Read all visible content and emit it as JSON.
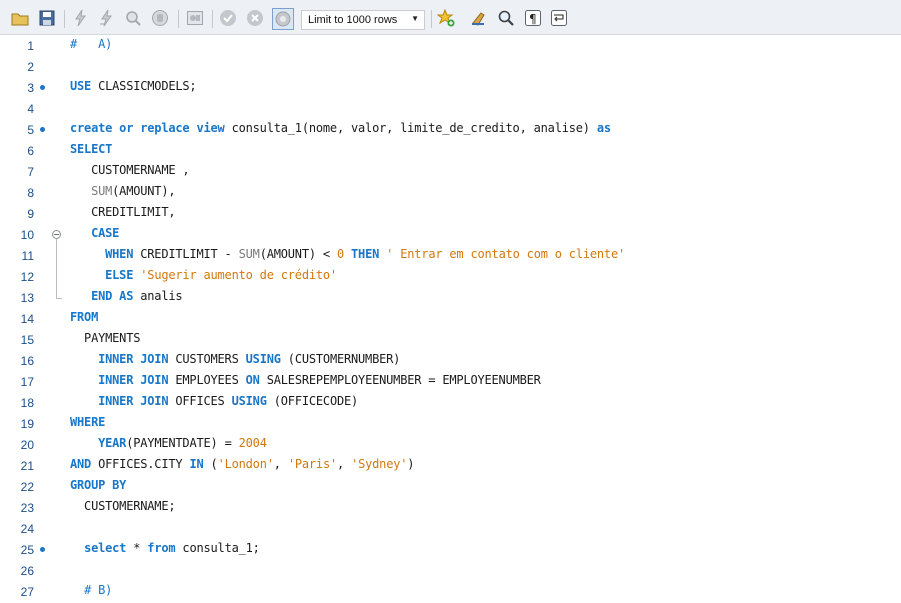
{
  "toolbar": {
    "limit_select_value": "Limit to 1000 rows"
  },
  "editor": {
    "lines": [
      {
        "n": "1",
        "dot": false,
        "tokens": [
          {
            "t": "#   A)",
            "c": "cm"
          }
        ]
      },
      {
        "n": "2",
        "dot": false,
        "tokens": []
      },
      {
        "n": "3",
        "dot": true,
        "tokens": [
          {
            "t": "USE",
            "c": "kw"
          },
          {
            "t": " CLASSICMODELS;",
            "c": ""
          }
        ]
      },
      {
        "n": "4",
        "dot": false,
        "tokens": []
      },
      {
        "n": "5",
        "dot": true,
        "tokens": [
          {
            "t": "create or replace view",
            "c": "kw"
          },
          {
            "t": " consulta_1(nome, valor, limite_de_credito, analise) ",
            "c": ""
          },
          {
            "t": "as",
            "c": "kw"
          }
        ]
      },
      {
        "n": "6",
        "dot": false,
        "tokens": [
          {
            "t": "SELECT",
            "c": "kw"
          }
        ]
      },
      {
        "n": "7",
        "dot": false,
        "tokens": [
          {
            "t": "   CUSTOMERNAME ,",
            "c": ""
          }
        ]
      },
      {
        "n": "8",
        "dot": false,
        "tokens": [
          {
            "t": "   ",
            "c": ""
          },
          {
            "t": "SUM",
            "c": "fn"
          },
          {
            "t": "(AMOUNT),",
            "c": ""
          }
        ]
      },
      {
        "n": "9",
        "dot": false,
        "tokens": [
          {
            "t": "   CREDITLIMIT,",
            "c": ""
          }
        ]
      },
      {
        "n": "10",
        "dot": false,
        "fold": "start",
        "tokens": [
          {
            "t": "   ",
            "c": ""
          },
          {
            "t": "CASE",
            "c": "kw"
          }
        ]
      },
      {
        "n": "11",
        "dot": false,
        "tokens": [
          {
            "t": "     ",
            "c": ""
          },
          {
            "t": "WHEN",
            "c": "kw"
          },
          {
            "t": " CREDITLIMIT - ",
            "c": ""
          },
          {
            "t": "SUM",
            "c": "fn"
          },
          {
            "t": "(AMOUNT) < ",
            "c": ""
          },
          {
            "t": "0",
            "c": "num"
          },
          {
            "t": " ",
            "c": ""
          },
          {
            "t": "THEN",
            "c": "kw"
          },
          {
            "t": " ",
            "c": ""
          },
          {
            "t": "' Entrar em contato com o cliente'",
            "c": "str"
          }
        ]
      },
      {
        "n": "12",
        "dot": false,
        "tokens": [
          {
            "t": "     ",
            "c": ""
          },
          {
            "t": "ELSE",
            "c": "kw"
          },
          {
            "t": " ",
            "c": ""
          },
          {
            "t": "'Sugerir aumento de crédito'",
            "c": "str"
          }
        ]
      },
      {
        "n": "13",
        "dot": false,
        "fold": "end",
        "tokens": [
          {
            "t": "   ",
            "c": ""
          },
          {
            "t": "END AS",
            "c": "kw"
          },
          {
            "t": " analis",
            "c": ""
          }
        ]
      },
      {
        "n": "14",
        "dot": false,
        "tokens": [
          {
            "t": "FROM",
            "c": "kw"
          }
        ]
      },
      {
        "n": "15",
        "dot": false,
        "tokens": [
          {
            "t": "  PAYMENTS",
            "c": ""
          }
        ]
      },
      {
        "n": "16",
        "dot": false,
        "tokens": [
          {
            "t": "    ",
            "c": ""
          },
          {
            "t": "INNER JOIN",
            "c": "kw"
          },
          {
            "t": " CUSTOMERS ",
            "c": ""
          },
          {
            "t": "USING",
            "c": "kw"
          },
          {
            "t": " (CUSTOMERNUMBER)",
            "c": ""
          }
        ]
      },
      {
        "n": "17",
        "dot": false,
        "tokens": [
          {
            "t": "    ",
            "c": ""
          },
          {
            "t": "INNER JOIN",
            "c": "kw"
          },
          {
            "t": " EMPLOYEES ",
            "c": ""
          },
          {
            "t": "ON",
            "c": "kw"
          },
          {
            "t": " SALESREPEMPLOYEENUMBER = EMPLOYEENUMBER",
            "c": ""
          }
        ]
      },
      {
        "n": "18",
        "dot": false,
        "tokens": [
          {
            "t": "    ",
            "c": ""
          },
          {
            "t": "INNER JOIN",
            "c": "kw"
          },
          {
            "t": " OFFICES ",
            "c": ""
          },
          {
            "t": "USING",
            "c": "kw"
          },
          {
            "t": " (OFFICECODE)",
            "c": ""
          }
        ]
      },
      {
        "n": "19",
        "dot": false,
        "tokens": [
          {
            "t": "WHERE",
            "c": "kw"
          }
        ]
      },
      {
        "n": "20",
        "dot": false,
        "tokens": [
          {
            "t": "    ",
            "c": ""
          },
          {
            "t": "YEAR",
            "c": "kw"
          },
          {
            "t": "(PAYMENTDATE) = ",
            "c": ""
          },
          {
            "t": "2004",
            "c": "num"
          }
        ]
      },
      {
        "n": "21",
        "dot": false,
        "tokens": [
          {
            "t": "AND",
            "c": "kw"
          },
          {
            "t": " OFFICES.CITY ",
            "c": ""
          },
          {
            "t": "IN",
            "c": "kw"
          },
          {
            "t": " (",
            "c": ""
          },
          {
            "t": "'London'",
            "c": "str"
          },
          {
            "t": ", ",
            "c": ""
          },
          {
            "t": "'Paris'",
            "c": "str"
          },
          {
            "t": ", ",
            "c": ""
          },
          {
            "t": "'Sydney'",
            "c": "str"
          },
          {
            "t": ")",
            "c": ""
          }
        ]
      },
      {
        "n": "22",
        "dot": false,
        "tokens": [
          {
            "t": "GROUP BY",
            "c": "kw"
          }
        ]
      },
      {
        "n": "23",
        "dot": false,
        "tokens": [
          {
            "t": "  CUSTOMERNAME;",
            "c": ""
          }
        ]
      },
      {
        "n": "24",
        "dot": false,
        "tokens": []
      },
      {
        "n": "25",
        "dot": true,
        "tokens": [
          {
            "t": "  ",
            "c": ""
          },
          {
            "t": "select",
            "c": "kw"
          },
          {
            "t": " * ",
            "c": ""
          },
          {
            "t": "from",
            "c": "kw"
          },
          {
            "t": " consulta_1;",
            "c": ""
          }
        ]
      },
      {
        "n": "26",
        "dot": false,
        "tokens": []
      },
      {
        "n": "27",
        "dot": false,
        "tokens": [
          {
            "t": "  ",
            "c": ""
          },
          {
            "t": "# B)",
            "c": "cm"
          }
        ]
      }
    ]
  }
}
